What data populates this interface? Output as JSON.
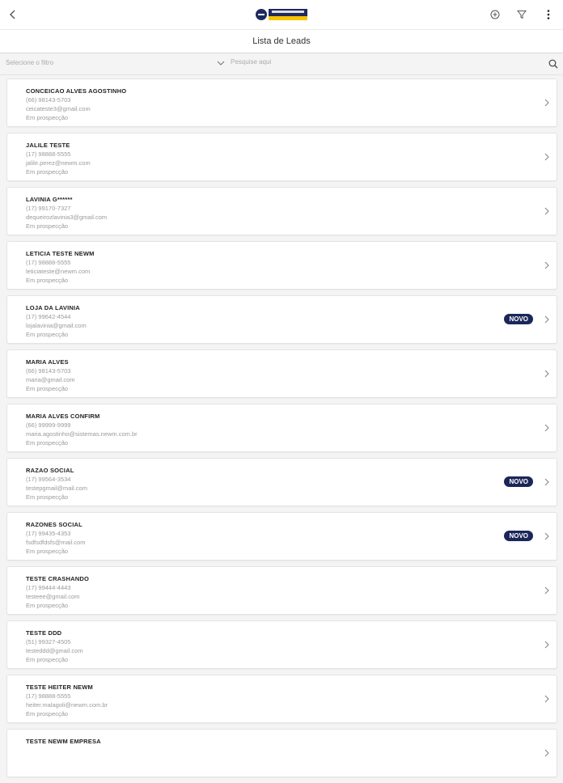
{
  "app": {
    "logo_name": "company-logo",
    "colors": {
      "brand_navy": "#1b2659",
      "brand_yellow": "#f4c400",
      "background": "#f4f4f4"
    }
  },
  "header": {
    "icons": [
      "chevron-left-icon",
      "add-circle-icon",
      "filter-icon",
      "more-vert-icon"
    ]
  },
  "page": {
    "title": "Lista de Leads"
  },
  "filter": {
    "select_label": "Selecione o filtro",
    "search_placeholder": "Pesquise aqui"
  },
  "leads": [
    {
      "name": "CONCEICAO ALVES AGOSTINHO",
      "phone": "(66) 98143-5703",
      "email": "ceicateste3@gmail.com",
      "status": "Em prospecção",
      "badge": ""
    },
    {
      "name": "JALILE TESTE",
      "phone": "(17) 98888-5555",
      "email": "jalile.perez@newm.com",
      "status": "Em prospecção",
      "badge": ""
    },
    {
      "name": "LAVINIA G******",
      "phone": "(17) 99170-7327",
      "email": "dequeirozlavinia3@gmail.com",
      "status": "Em prospecção",
      "badge": ""
    },
    {
      "name": "LETICIA TESTE NEWM",
      "phone": "(17) 98888-5555",
      "email": "leticiateste@newm.com",
      "status": "Em prospecção",
      "badge": ""
    },
    {
      "name": "LOJA DA LAVINIA",
      "phone": "(17) 99642-4544",
      "email": "lojalavinia@gmail.com",
      "status": "Em prospecção",
      "badge": "NOVO"
    },
    {
      "name": "MARIA ALVES",
      "phone": "(66) 98143-5703",
      "email": "maria@gmail.com",
      "status": "Em prospecção",
      "badge": ""
    },
    {
      "name": "MARIA ALVES CONFIRM",
      "phone": "(66) 99999-9999",
      "email": "maria.agostinho@sistemas.newm.com.br",
      "status": "Em prospecção",
      "badge": ""
    },
    {
      "name": "RAZAO SOCIAL",
      "phone": "(17) 99564-3534",
      "email": "testepgmail@mail.com",
      "status": "Em prospecção",
      "badge": "NOVO"
    },
    {
      "name": "RAZONES SOCIAL",
      "phone": "(17) 99435-4353",
      "email": "fsdfsdfdsfs@mail.com",
      "status": "Em prospecção",
      "badge": "NOVO"
    },
    {
      "name": "TESTE CRASHANDO",
      "phone": "(17) 99444-4443",
      "email": "testeee@gmail.com",
      "status": "Em prospecção",
      "badge": ""
    },
    {
      "name": "TESTE DDD",
      "phone": "(51) 99327-4505",
      "email": "testeddd@gmail.com",
      "status": "Em prospecção",
      "badge": ""
    },
    {
      "name": "TESTE HEITER NEWM",
      "phone": "(17) 98888-5555",
      "email": "heiter.malagoli@newm.com.br",
      "status": "Em prospecção",
      "badge": ""
    },
    {
      "name": "TESTE NEWM EMPRESA",
      "phone": "",
      "email": "",
      "status": "",
      "badge": ""
    }
  ]
}
